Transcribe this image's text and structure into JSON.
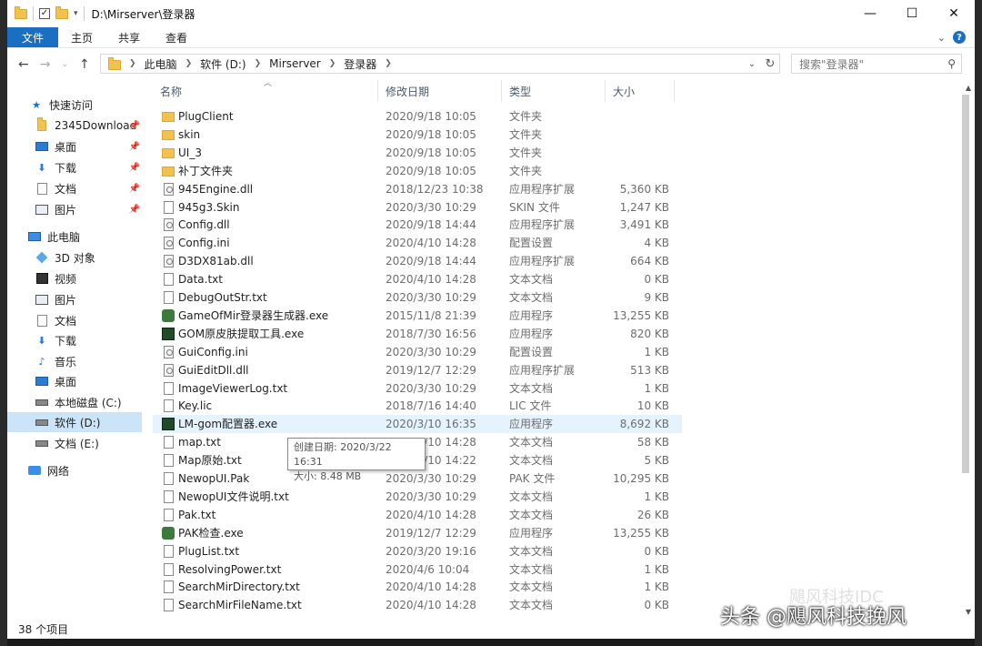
{
  "window": {
    "title": "D:\\Mirserver\\登录器",
    "controls": [
      "—",
      "☐",
      "✕"
    ]
  },
  "ribbon": {
    "tabs": [
      "文件",
      "主页",
      "共享",
      "查看"
    ],
    "expand": "⌄",
    "help": "?"
  },
  "address": {
    "breadcrumbs": [
      "此电脑",
      "软件 (D:)",
      "Mirserver",
      "登录器"
    ],
    "search_placeholder": "搜索\"登录器\""
  },
  "sidebar": {
    "items": [
      {
        "label": "快速访问",
        "icon": "star-icon",
        "pinned": false
      },
      {
        "label": "2345Download",
        "icon": "folder-icon",
        "pinned": true
      },
      {
        "label": "桌面",
        "icon": "desktop-icon",
        "pinned": true
      },
      {
        "label": "下载",
        "icon": "download-icon",
        "pinned": true
      },
      {
        "label": "文档",
        "icon": "document-icon",
        "pinned": true
      },
      {
        "label": "图片",
        "icon": "picture-icon",
        "pinned": true
      },
      {
        "label": "此电脑",
        "icon": "computer-icon",
        "pinned": false
      },
      {
        "label": "3D 对象",
        "icon": "3d-objects-icon",
        "pinned": false
      },
      {
        "label": "视频",
        "icon": "video-icon",
        "pinned": false
      },
      {
        "label": "图片",
        "icon": "picture-icon",
        "pinned": false
      },
      {
        "label": "文档",
        "icon": "document-icon",
        "pinned": false
      },
      {
        "label": "下载",
        "icon": "download-icon",
        "pinned": false
      },
      {
        "label": "音乐",
        "icon": "music-icon",
        "pinned": false
      },
      {
        "label": "桌面",
        "icon": "desktop-icon",
        "pinned": false
      },
      {
        "label": "本地磁盘 (C:)",
        "icon": "drive-icon",
        "pinned": false
      },
      {
        "label": "软件 (D:)",
        "icon": "drive-icon",
        "pinned": false,
        "selected": true
      },
      {
        "label": "文档 (E:)",
        "icon": "drive-icon",
        "pinned": false
      },
      {
        "label": "网络",
        "icon": "network-icon",
        "pinned": false
      }
    ]
  },
  "columns": {
    "name": "名称",
    "date": "修改日期",
    "type": "类型",
    "size": "大小"
  },
  "files": [
    {
      "name": "PlugClient",
      "date": "2020/9/18 10:05",
      "type": "文件夹",
      "size": "",
      "icon": "folder-icon"
    },
    {
      "name": "skin",
      "date": "2020/9/18 10:05",
      "type": "文件夹",
      "size": "",
      "icon": "folder-icon"
    },
    {
      "name": "UI_3",
      "date": "2020/9/18 10:05",
      "type": "文件夹",
      "size": "",
      "icon": "folder-icon"
    },
    {
      "name": "补丁文件夹",
      "date": "2020/9/18 10:05",
      "type": "文件夹",
      "size": "",
      "icon": "folder-icon"
    },
    {
      "name": "945Engine.dll",
      "date": "2018/12/23 10:38",
      "type": "应用程序扩展",
      "size": "5,360 KB",
      "icon": "dll-icon"
    },
    {
      "name": "945g3.Skin",
      "date": "2020/3/30 10:29",
      "type": "SKIN 文件",
      "size": "1,247 KB",
      "icon": "file-icon"
    },
    {
      "name": "Config.dll",
      "date": "2020/9/18 14:44",
      "type": "应用程序扩展",
      "size": "3,491 KB",
      "icon": "dll-icon"
    },
    {
      "name": "Config.ini",
      "date": "2020/4/10 14:28",
      "type": "配置设置",
      "size": "4 KB",
      "icon": "dll-icon"
    },
    {
      "name": "D3DX81ab.dll",
      "date": "2020/9/18 14:44",
      "type": "应用程序扩展",
      "size": "664 KB",
      "icon": "dll-icon"
    },
    {
      "name": "Data.txt",
      "date": "2020/4/10 14:28",
      "type": "文本文档",
      "size": "0 KB",
      "icon": "file-icon"
    },
    {
      "name": "DebugOutStr.txt",
      "date": "2020/3/30 10:29",
      "type": "文本文档",
      "size": "9 KB",
      "icon": "file-icon"
    },
    {
      "name": "GameOfMir登录器生成器.exe",
      "date": "2015/11/8 21:39",
      "type": "应用程序",
      "size": "13,255 KB",
      "icon": "mir-exe-icon"
    },
    {
      "name": "GOM原皮肤提取工具.exe",
      "date": "2018/7/30 16:56",
      "type": "应用程序",
      "size": "820 KB",
      "icon": "gom-exe-icon"
    },
    {
      "name": "GuiConfig.ini",
      "date": "2020/3/30 10:29",
      "type": "配置设置",
      "size": "1 KB",
      "icon": "dll-icon"
    },
    {
      "name": "GuiEditDll.dll",
      "date": "2019/12/7 12:29",
      "type": "应用程序扩展",
      "size": "513 KB",
      "icon": "dll-icon"
    },
    {
      "name": "ImageViewerLog.txt",
      "date": "2020/3/30 10:29",
      "type": "文本文档",
      "size": "1 KB",
      "icon": "file-icon"
    },
    {
      "name": "Key.lic",
      "date": "2018/7/16 14:40",
      "type": "LIC 文件",
      "size": "10 KB",
      "icon": "file-icon"
    },
    {
      "name": "LM-gom配置器.exe",
      "date": "2020/3/10 16:35",
      "type": "应用程序",
      "size": "8,692 KB",
      "icon": "gom-exe-icon",
      "hover": true
    },
    {
      "name": "map.txt",
      "date": "2020/3/10 14:28",
      "type": "文本文档",
      "size": "58 KB",
      "icon": "file-icon"
    },
    {
      "name": "Map原始.txt",
      "date": "2020/3/10 14:22",
      "type": "文本文档",
      "size": "5 KB",
      "icon": "file-icon"
    },
    {
      "name": "NewopUI.Pak",
      "date": "2020/3/30 10:29",
      "type": "PAK 文件",
      "size": "10,295 KB",
      "icon": "file-icon"
    },
    {
      "name": "NewopUI文件说明.txt",
      "date": "2020/3/30 10:29",
      "type": "文本文档",
      "size": "1 KB",
      "icon": "file-icon"
    },
    {
      "name": "Pak.txt",
      "date": "2020/4/10 14:28",
      "type": "文本文档",
      "size": "26 KB",
      "icon": "file-icon"
    },
    {
      "name": "PAK检查.exe",
      "date": "2019/12/7 12:29",
      "type": "应用程序",
      "size": "13,255 KB",
      "icon": "mir-exe-icon"
    },
    {
      "name": "PlugList.txt",
      "date": "2020/3/20 19:16",
      "type": "文本文档",
      "size": "0 KB",
      "icon": "file-icon"
    },
    {
      "name": "ResolvingPower.txt",
      "date": "2020/4/6 10:04",
      "type": "文本文档",
      "size": "1 KB",
      "icon": "file-icon"
    },
    {
      "name": "SearchMirDirectory.txt",
      "date": "2020/4/10 14:28",
      "type": "文本文档",
      "size": "1 KB",
      "icon": "file-icon"
    },
    {
      "name": "SearchMirFileName.txt",
      "date": "2020/4/10 14:28",
      "type": "文本文档",
      "size": "0 KB",
      "icon": "file-icon"
    }
  ],
  "tooltip": {
    "created": "创建日期: 2020/3/22 16:31",
    "size": "大小: 8.48 MB"
  },
  "status": {
    "count": "38 个项目"
  },
  "watermark": {
    "text": "头条 @飓风科技挽风",
    "faint": "飓风科技IDC"
  }
}
